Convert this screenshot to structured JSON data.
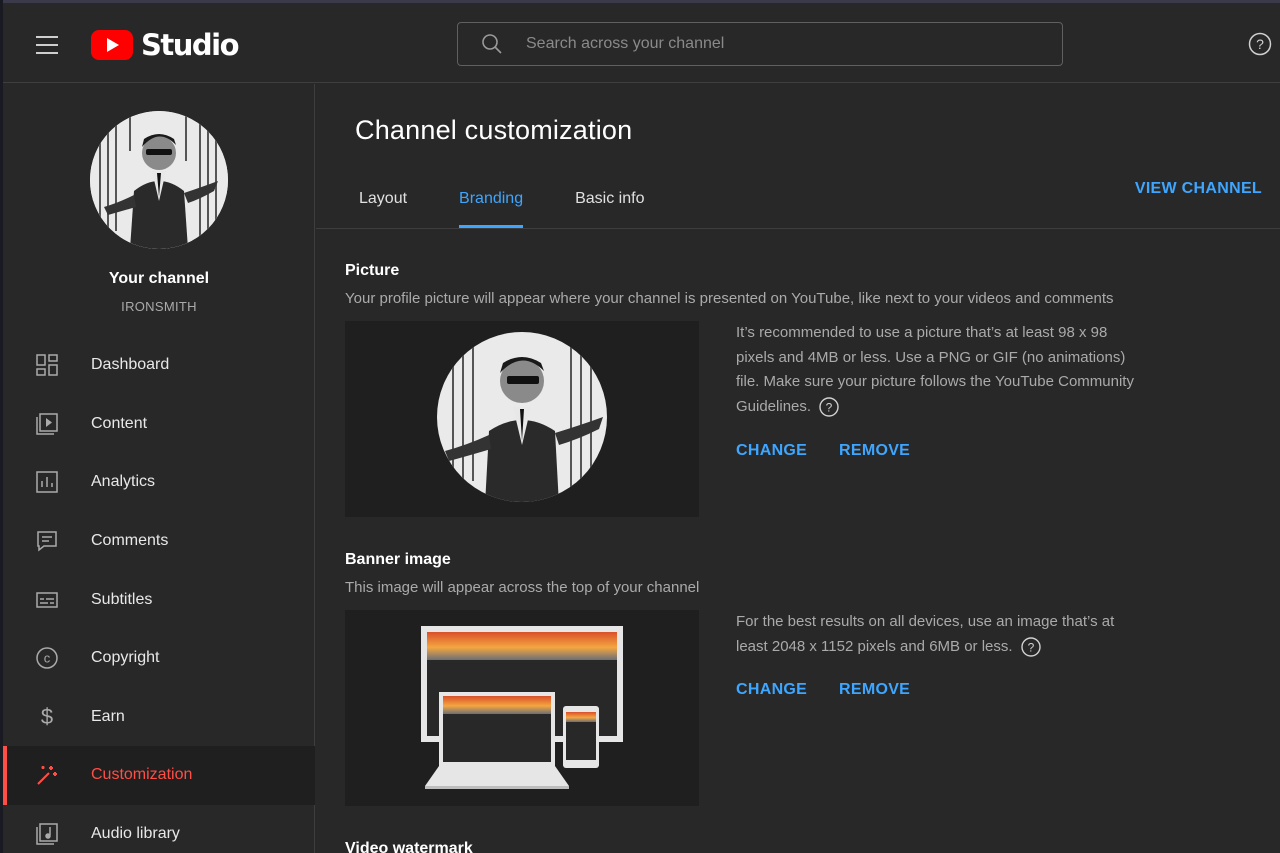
{
  "header": {
    "logo_text": "Studio",
    "search_placeholder": "Search across your channel",
    "icons": {
      "menu": "hamburger-menu-icon",
      "search": "search-icon",
      "help": "help-circle-icon"
    },
    "brand_color": "#ff0000"
  },
  "sidebar": {
    "channel_title": "Your channel",
    "channel_name": "IRONSMITH",
    "items": [
      {
        "label": "Dashboard",
        "icon": "dashboard-icon"
      },
      {
        "label": "Content",
        "icon": "content-icon"
      },
      {
        "label": "Analytics",
        "icon": "analytics-icon"
      },
      {
        "label": "Comments",
        "icon": "comments-icon"
      },
      {
        "label": "Subtitles",
        "icon": "subtitles-icon"
      },
      {
        "label": "Copyright",
        "icon": "copyright-icon"
      },
      {
        "label": "Earn",
        "icon": "dollar-icon"
      },
      {
        "label": "Customization",
        "icon": "magic-wand-icon",
        "active": true
      },
      {
        "label": "Audio library",
        "icon": "audio-library-icon"
      }
    ],
    "active_color": "#ff4e45"
  },
  "main": {
    "page_title": "Channel customization",
    "tabs": [
      {
        "label": "Layout"
      },
      {
        "label": "Branding",
        "active": true
      },
      {
        "label": "Basic info"
      }
    ],
    "view_channel": "VIEW CHANNEL",
    "accent_color": "#3ea6ff",
    "picture": {
      "title": "Picture",
      "description": "Your profile picture will appear where your channel is presented on YouTube, like next to your videos and comments",
      "info": "It’s recommended to use a picture that’s at least 98 x 98 pixels and 4MB or less. Use a PNG or GIF (no animations) file. Make sure your picture follows the YouTube Community Guidelines.",
      "change": "CHANGE",
      "remove": "REMOVE"
    },
    "banner": {
      "title": "Banner image",
      "description": "This image will appear across the top of your channel",
      "info": "For the best results on all devices, use an image that’s at least 2048 x 1152 pixels and 6MB or less.",
      "change": "CHANGE",
      "remove": "REMOVE"
    },
    "watermark": {
      "title": "Video watermark"
    }
  }
}
